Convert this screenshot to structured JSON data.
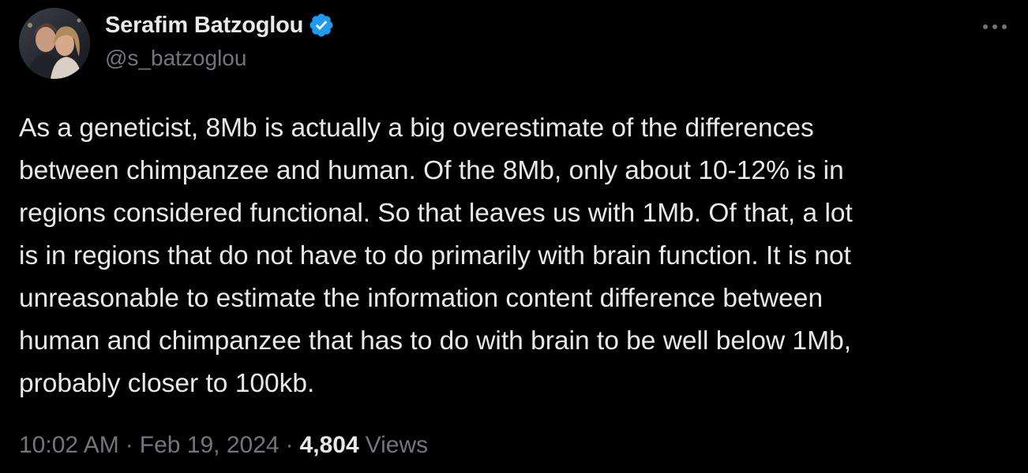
{
  "author": {
    "display_name": "Serafim Batzoglou",
    "handle": "@s_batzoglou",
    "verified": true,
    "verified_color": "#1d9bf0"
  },
  "tweet": {
    "text": "As a geneticist, 8Mb is actually a big overestimate of the differences\nbetween chimpanzee and human. Of the 8Mb, only about 10-12% is in\nregions considered functional. So that leaves us with 1Mb. Of that, a lot\nis in regions that do not have to do primarily with brain function. It is not\nunreasonable to estimate the information content difference between\nhuman and chimpanzee that has to do with brain to be well below 1Mb,\nprobably closer to 100kb."
  },
  "meta": {
    "time": "10:02 AM",
    "separator": "·",
    "date": "Feb 19, 2024",
    "views_count": "4,804",
    "views_label": "Views"
  },
  "icons": {
    "more": "more-horizontal-icon",
    "verified": "verified-badge-icon"
  },
  "colors": {
    "background": "#000000",
    "primary_text": "#e7e9ea",
    "secondary_text": "#71767b"
  }
}
